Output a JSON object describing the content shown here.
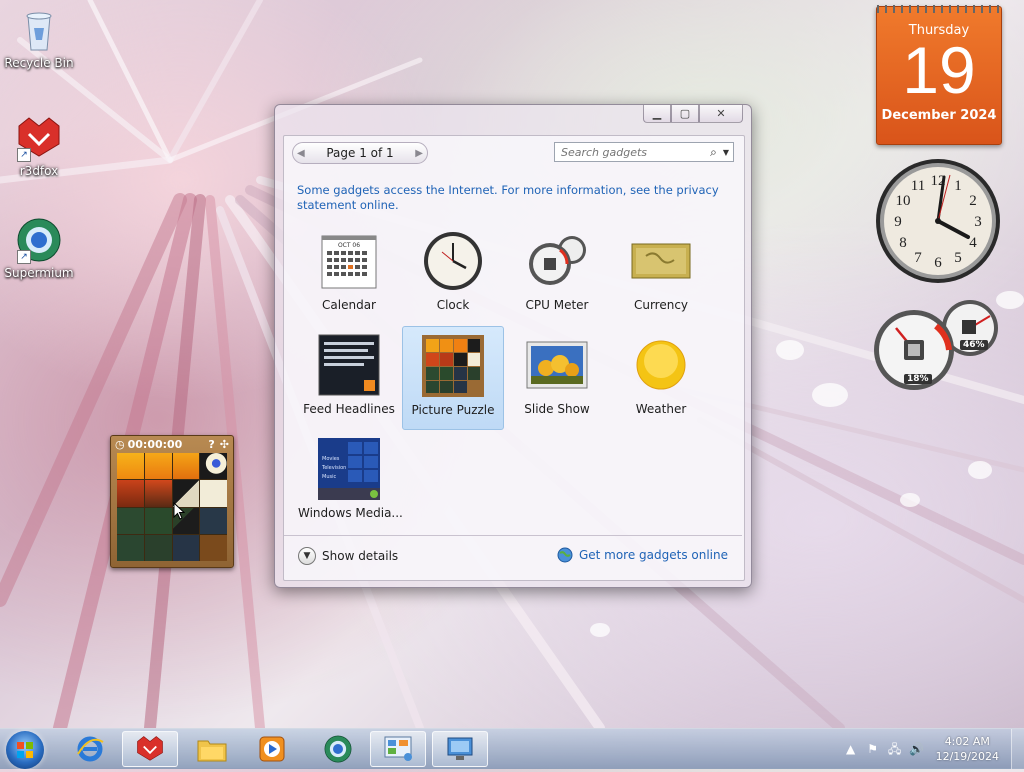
{
  "desktop": {
    "icons": [
      {
        "label": "Recycle Bin",
        "icon": "recycle-bin-icon"
      },
      {
        "label": "r3dfox",
        "icon": "r3dfox-icon"
      },
      {
        "label": "Supermium",
        "icon": "supermium-icon"
      }
    ]
  },
  "calendar_gadget": {
    "weekday": "Thursday",
    "day": "19",
    "month_year": "December 2024"
  },
  "clock_gadget": {
    "numerals": [
      "12",
      "1",
      "2",
      "3",
      "4",
      "5",
      "6",
      "7",
      "8",
      "9",
      "10",
      "11"
    ]
  },
  "cpu_gadget": {
    "cpu_percent": "18%",
    "memory_percent": "46%"
  },
  "puzzle_gadget": {
    "timer": "00:00:00"
  },
  "gadget_window": {
    "pager_label": "Page 1 of 1",
    "search_placeholder": "Search gadgets",
    "info_text": "Some gadgets access the Internet.  For more information, see the privacy statement online.",
    "gadgets": [
      {
        "label": "Calendar",
        "icon": "calendar-gadget-icon"
      },
      {
        "label": "Clock",
        "icon": "clock-gadget-icon"
      },
      {
        "label": "CPU Meter",
        "icon": "cpu-meter-gadget-icon"
      },
      {
        "label": "Currency",
        "icon": "currency-gadget-icon"
      },
      {
        "label": "Feed Headlines",
        "icon": "feed-headlines-gadget-icon"
      },
      {
        "label": "Picture Puzzle",
        "icon": "picture-puzzle-gadget-icon",
        "selected": true
      },
      {
        "label": "Slide Show",
        "icon": "slide-show-gadget-icon"
      },
      {
        "label": "Weather",
        "icon": "weather-gadget-icon"
      },
      {
        "label": "Windows Media...",
        "icon": "windows-media-gadget-icon"
      }
    ],
    "calendar_icon_month": "OCT 06",
    "media_menu": [
      "Movies",
      "Television",
      "Music"
    ],
    "show_details": "Show details",
    "get_more": "Get more gadgets online"
  },
  "taskbar": {
    "time": "4:02 AM",
    "date": "12/19/2024",
    "items": [
      "internet-explorer-icon",
      "r3dfox-icon",
      "file-explorer-icon",
      "media-player-icon",
      "supermium-icon",
      "gadgets-icon",
      "network-monitor-icon"
    ]
  }
}
